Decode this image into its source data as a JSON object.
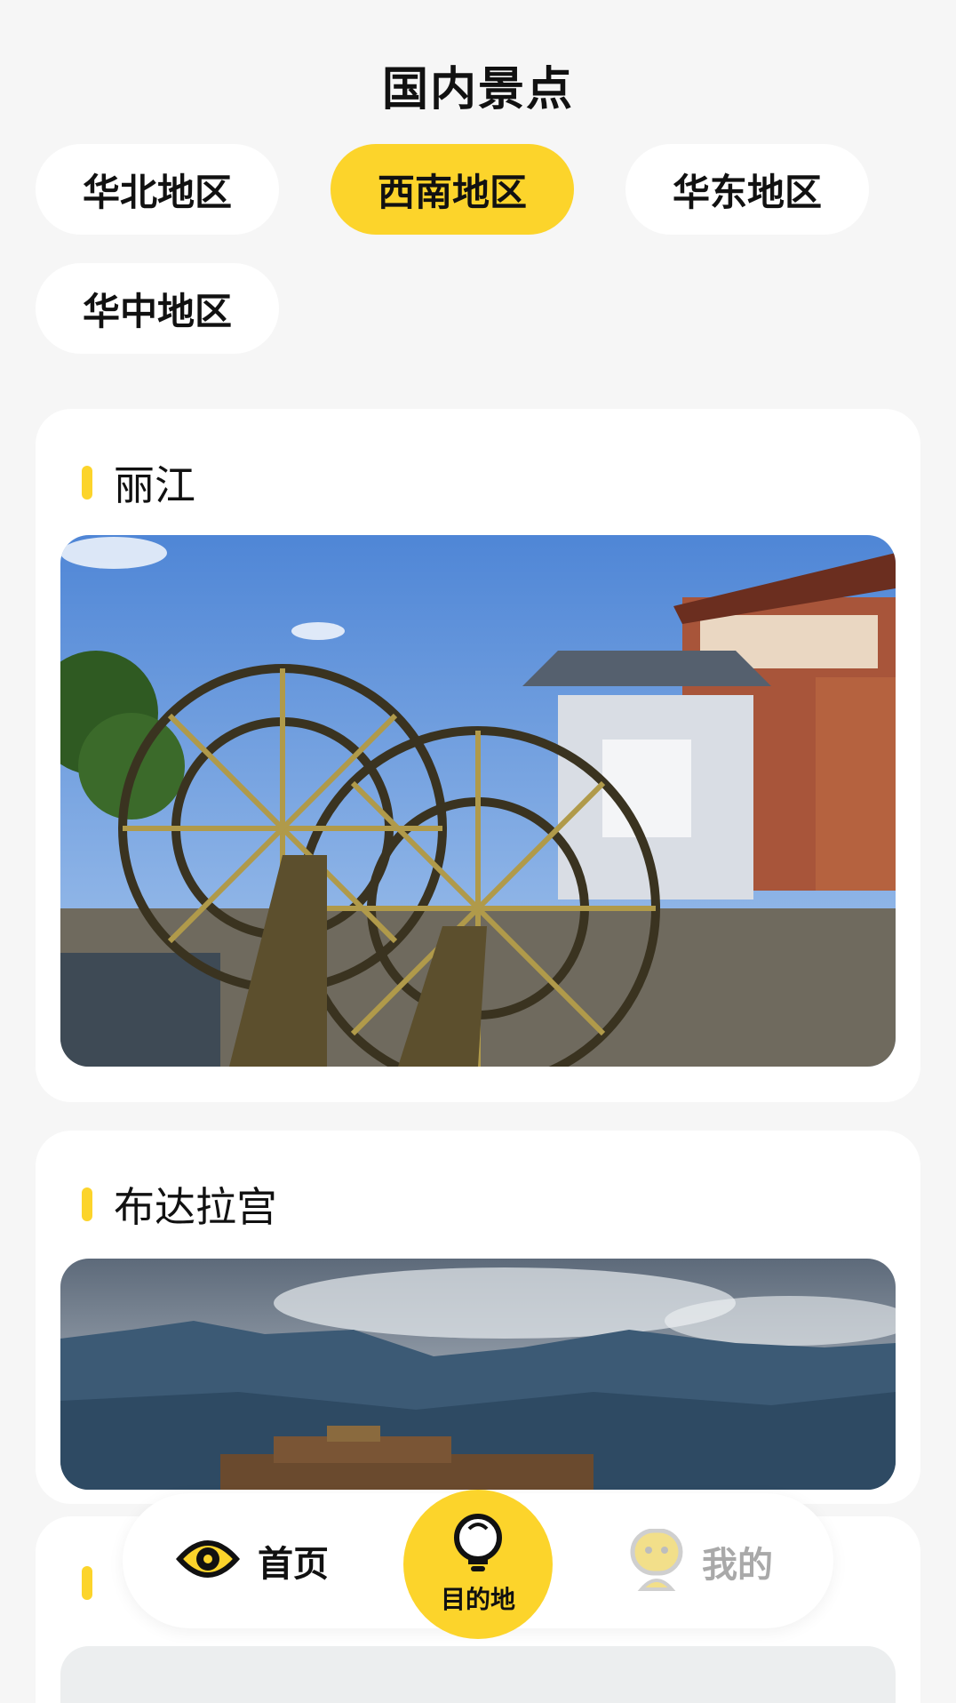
{
  "header": {
    "title": "国内景点"
  },
  "regions": [
    {
      "label": "华北地区",
      "active": false
    },
    {
      "label": "西南地区",
      "active": true
    },
    {
      "label": "华东地区",
      "active": false
    },
    {
      "label": "华中地区",
      "active": false
    }
  ],
  "attractions": [
    {
      "name": "丽江",
      "image": "lijiang-waterwheel-photo"
    },
    {
      "name": "布达拉宫",
      "image": "potala-palace-photo"
    }
  ],
  "tabbar": {
    "items": [
      {
        "label": "首页",
        "icon": "eye-icon"
      },
      {
        "label": "目的地",
        "icon": "lightbulb-icon",
        "active": true
      },
      {
        "label": "我的",
        "icon": "face-icon"
      }
    ]
  },
  "colors": {
    "accent": "#fcd42b",
    "background": "#f6f6f6",
    "inactive_text": "#a9a9a9"
  }
}
